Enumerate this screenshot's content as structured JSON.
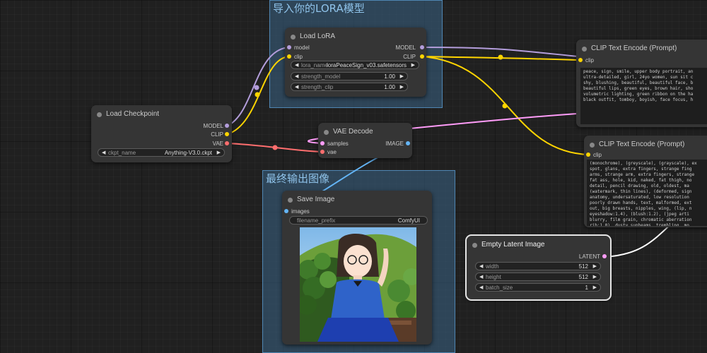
{
  "groups": {
    "lora": {
      "title": "导入你的LORA模型"
    },
    "output": {
      "title": "最终输出图像"
    }
  },
  "nodes": {
    "load_checkpoint": {
      "title": "Load Checkpoint",
      "outputs": [
        "MODEL",
        "CLIP",
        "VAE"
      ],
      "ckpt_name": {
        "label": "ckpt_name",
        "value": "Anything-V3.0.ckpt"
      }
    },
    "load_lora": {
      "title": "Load LoRA",
      "inputs": [
        "model",
        "clip"
      ],
      "outputs": [
        "MODEL",
        "CLIP"
      ],
      "lora_name": {
        "label": "lora_name",
        "value": "loraPeaceSign_v03.safetensors"
      },
      "strength_model": {
        "label": "strength_model",
        "value": "1.00"
      },
      "strength_clip": {
        "label": "strength_clip",
        "value": "1.00"
      }
    },
    "vae_decode": {
      "title": "VAE Decode",
      "inputs": [
        "samples",
        "vae"
      ],
      "outputs": [
        "IMAGE"
      ]
    },
    "save_image": {
      "title": "Save Image",
      "inputs": [
        "images"
      ],
      "filename_prefix": {
        "label": "filename_prefix",
        "value": "ComfyUI"
      }
    },
    "clip_positive": {
      "title": "CLIP Text Encode (Prompt)",
      "inputs": [
        "clip"
      ],
      "text": "peace, sign, smile, upper body portrait, an\nultra-detailed, girl, 24yo women, sun sit c\nshy, blushing, beautiful, beautiful face, b\nbeautiful lips, green eyes, brown hair, sho\nvolumetric lighting, green ribbon on the ha\nblack outfit, tomboy, boyish, face focus, h"
    },
    "clip_negative": {
      "title": "CLIP Text Encode (Prompt)",
      "inputs": [
        "clip"
      ],
      "text": "(monochrome), (greyscale), (grayscale), ex\nspot, glans, extra fingers, strange fing\narms, strange arm, extra fingers, strange\nfat ass, hole, kid, naked, fat thigh, no\ndetail, pencil drawing, old, oldest, ma\n(watermark, thin lines), (deformed, sign\nanatomy, undersaturated, low resolution\npoorly drawn hands, text, malformed, ext\nout, big breasts, nipples, wing, (lip, n\neyeshadow:1.4), (blush:1.2), (jpeg arti\nblurry, film grain, chromatic aberration\nrib:1.0), dusty sunbeams, trembling, mo\nlines, title, logo, white frame, freckl"
    },
    "empty_latent": {
      "title": "Empty Latent Image",
      "outputs": [
        "LATENT"
      ],
      "width": {
        "label": "width",
        "value": "512"
      },
      "height": {
        "label": "height",
        "value": "512"
      },
      "batch_size": {
        "label": "batch_size",
        "value": "1"
      }
    }
  },
  "colors": {
    "model": "#b39ddb",
    "clip": "#ffd500",
    "vae": "#ff6e6e",
    "conditioning": "#ffa931",
    "latent": "#ff9cf9",
    "image": "#64b5f6"
  }
}
